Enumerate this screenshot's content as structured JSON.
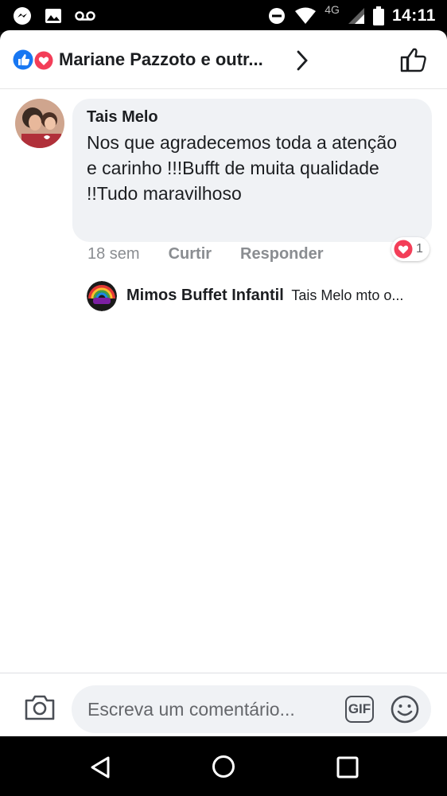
{
  "status_bar": {
    "icons_left": [
      "messenger-icon",
      "image-icon",
      "voicemail-icon"
    ],
    "network": "4G",
    "time": "14:11"
  },
  "header": {
    "reaction_icons": [
      "like-reaction-icon",
      "love-reaction-icon"
    ],
    "title": "Mariane Pazzoto e outr...",
    "colors": {
      "like_blue": "#1877f2",
      "love_red": "#f33e58"
    }
  },
  "comment": {
    "author": "Tais Melo",
    "text": "Nos que agradecemos toda a atenção e carinho !!!Bufft de muita qualidade !!Tudo maravilhoso",
    "time": "18 sem",
    "like_label": "Curtir",
    "reply_label": "Responder",
    "reaction_count": "1"
  },
  "reply": {
    "author": "Mimos Buffet Infantil",
    "snippet": "Tais Melo mto o..."
  },
  "composer": {
    "placeholder": "Escreva um comentário...",
    "gif_label": "GIF"
  }
}
